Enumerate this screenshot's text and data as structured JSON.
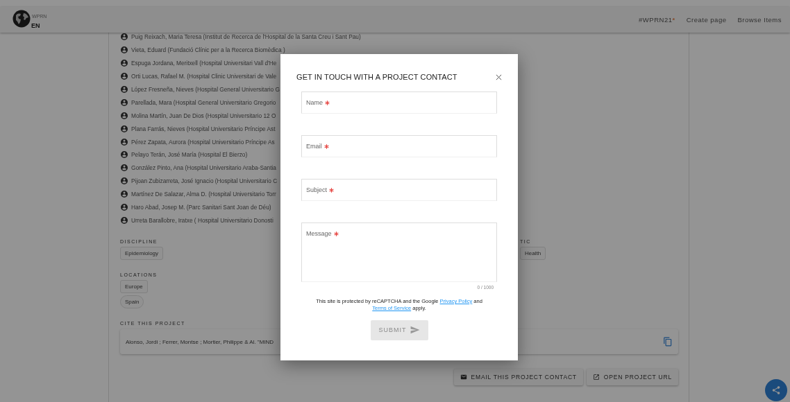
{
  "header": {
    "logo_text": "WPRN",
    "language": "EN",
    "nav": [
      {
        "kind": "tag",
        "label": "#WPRN21",
        "mark": "*"
      },
      {
        "kind": "link",
        "label": "Create page"
      },
      {
        "kind": "link",
        "label": "Browse Items"
      }
    ]
  },
  "contacts": [
    "Puig Reixach, Maria Teresa (Institut de Recerca de l'Hospital de la Santa Creu i Sant Pau)",
    "Vieta, Eduard (Fundació Clínic per a la Recerca Biomèdica )",
    "Espuga Jordana, Meritxell (Hospital Universitari Vall d'He",
    "Orti Lucas, Rafael M. (Hospital Clinic Universitari de Vale",
    "López Fresneña, Nieves (Hospital General Universitario G",
    "Parellada, Mara (Hospital General Universitario Gregorio",
    "Molina Martín, Juan De Dios (Hospital Universitario 12 O",
    "Plana Farrás, Nieves (Hospital Universitario Príncipe Ast",
    "Pérez Zapata, Aurora (Hospital Universitario Príncipe As",
    "Pelayo Terán, José María (Hospital El Bierzo)",
    "González Pinto, Ana (Hospital Universitario Araba-Santia",
    "Pijoan Zubizarreta, José Ignacio (Hospital Universitario C",
    "Martínez De Salazar, Alma D. (Hospital Universitario Torr",
    "Haro Abad, Josep M. (Parc Sanitari Sant Joan de Déu)",
    "Urreta Barallobre, Iratxe ( Hospital Universitario Donosti"
  ],
  "discipline": {
    "label": "DISCIPLINE",
    "chips": [
      "Epidemiology"
    ]
  },
  "topic": {
    "label": "TIC",
    "chips": [
      "Health"
    ]
  },
  "locations": {
    "label": "LOCATIONS",
    "chips": [
      "Europe",
      "Spain"
    ]
  },
  "cite": {
    "label": "CITE THIS PROJECT",
    "text": "Alonso, Jordi ; Ferrer, Montse ; Mortier, Philippe & Al. \"MIND"
  },
  "actions": [
    {
      "kind": "email",
      "label": "EMAIL THIS PROJECT CONTACT"
    },
    {
      "kind": "open",
      "label": "OPEN PROJECT URL"
    }
  ],
  "dialog": {
    "title": "GET IN TOUCH WITH A PROJECT CONTACT",
    "fields": [
      {
        "kind": "line",
        "placeholder": "Name",
        "required": true
      },
      {
        "kind": "line",
        "placeholder": "Email",
        "required": true
      },
      {
        "kind": "line",
        "placeholder": "Subject",
        "required": true
      },
      {
        "kind": "area",
        "placeholder": "Message",
        "required": true,
        "counter": "0 / 1000"
      }
    ],
    "notice": {
      "before": "This site is protected by reCAPTCHA and the Google",
      "link1": "Privacy Policy",
      "middle": "and",
      "link2": "Terms of Service",
      "after": "apply."
    },
    "submit": {
      "label": "SUBMIT",
      "disabled": true
    }
  }
}
